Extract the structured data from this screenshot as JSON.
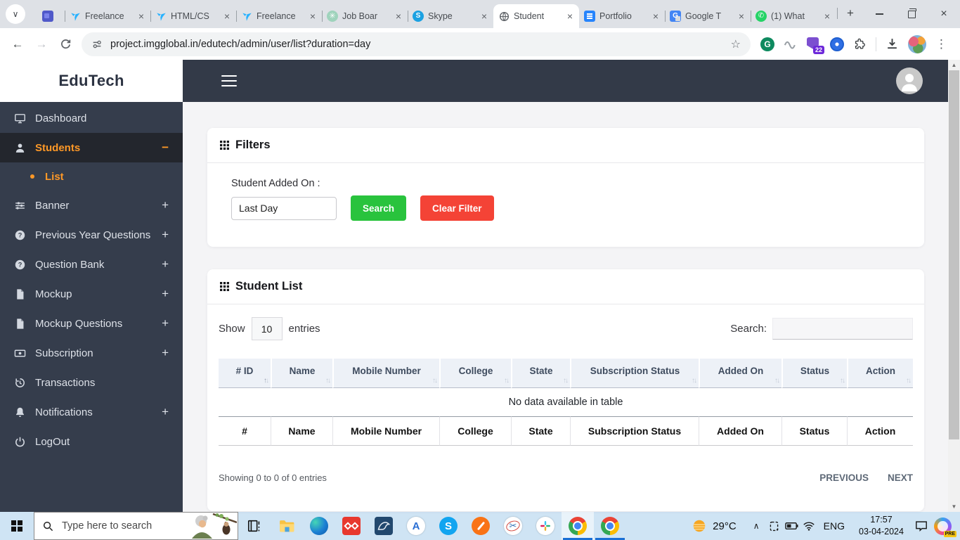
{
  "colors": {
    "accent_orange": "#fd9827",
    "success_green": "#29c33d",
    "danger_red": "#f44336",
    "sidebar_dark": "#353d4c",
    "topbar_dark": "#333a48",
    "taskbar_blue": "#cfe4f4",
    "table_header_bg": "#edf1f7",
    "run_indicator_blue": "#1a6fd4"
  },
  "icons": {
    "close": "×",
    "plus": "+",
    "back": "←",
    "forward": "→",
    "sort_up": "↑",
    "sort_down": "↓",
    "star": "☆",
    "menu_dots": "⋮",
    "chevron_down": "∨",
    "chevron_up": "∧",
    "scroll_up": "▲",
    "scroll_down": "▼",
    "skype_s": "S",
    "grammarly_g": "G",
    "translate_g": "G",
    "a_letter": "A",
    "whatsapp_phone": "✆",
    "chatgpt_knot": "✳",
    "scissors": "✂"
  },
  "browser": {
    "url": "project.imgglobal.in/edutech/admin/user/list?duration=day",
    "extension_badge": "22",
    "tabs": [
      {
        "title": "",
        "icon": "teams"
      },
      {
        "title": "Freelance",
        "icon": "freelancer"
      },
      {
        "title": "HTML/CS",
        "icon": "freelancer"
      },
      {
        "title": "Freelance",
        "icon": "freelancer"
      },
      {
        "title": "Job Boar",
        "icon": "chatgpt"
      },
      {
        "title": "Skype",
        "icon": "skype"
      },
      {
        "title": "Student",
        "icon": "globe",
        "active": true
      },
      {
        "title": "Portfolio",
        "icon": "google-docs"
      },
      {
        "title": "Google T",
        "icon": "google-translate"
      },
      {
        "title": "(1) What",
        "icon": "whatsapp"
      }
    ]
  },
  "sidebar": {
    "brand": "EduTech",
    "items": [
      {
        "label": "Dashboard",
        "expand": ""
      },
      {
        "label": "Students",
        "expand": "−",
        "active": true
      },
      {
        "label": "List",
        "sub": true,
        "active": true
      },
      {
        "label": "Banner",
        "expand": "+"
      },
      {
        "label": "Previous Year Questions",
        "expand": "+"
      },
      {
        "label": "Question Bank",
        "expand": "+"
      },
      {
        "label": "Mockup",
        "expand": "+"
      },
      {
        "label": "Mockup Questions",
        "expand": "+"
      },
      {
        "label": "Subscription",
        "expand": "+"
      },
      {
        "label": "Transactions",
        "expand": ""
      },
      {
        "label": "Notifications",
        "expand": "+"
      },
      {
        "label": "LogOut",
        "expand": ""
      }
    ]
  },
  "filters": {
    "title": "Filters",
    "field_label": "Student Added On :",
    "field_value": "Last Day",
    "search_button": "Search",
    "clear_button": "Clear Filter"
  },
  "student_list": {
    "title": "Student List",
    "show_label": "Show",
    "page_size": "10",
    "entries_label": "entries",
    "search_label": "Search:",
    "columns": [
      "# ID",
      "Name",
      "Mobile Number",
      "College",
      "State",
      "Subscription Status",
      "Added On",
      "Status",
      "Action"
    ],
    "footer_columns": [
      "#",
      "Name",
      "Mobile Number",
      "College",
      "State",
      "Subscription Status",
      "Added On",
      "Status",
      "Action"
    ],
    "empty_text": "No data available in table",
    "summary": "Showing 0 to 0 of 0 entries",
    "previous_label": "PREVIOUS",
    "next_label": "NEXT"
  },
  "taskbar": {
    "search_placeholder": "Type here to search",
    "temperature": "29°C",
    "language": "ENG",
    "time": "17:57",
    "date": "03-04-2024",
    "copilot_badge": "PRE"
  }
}
